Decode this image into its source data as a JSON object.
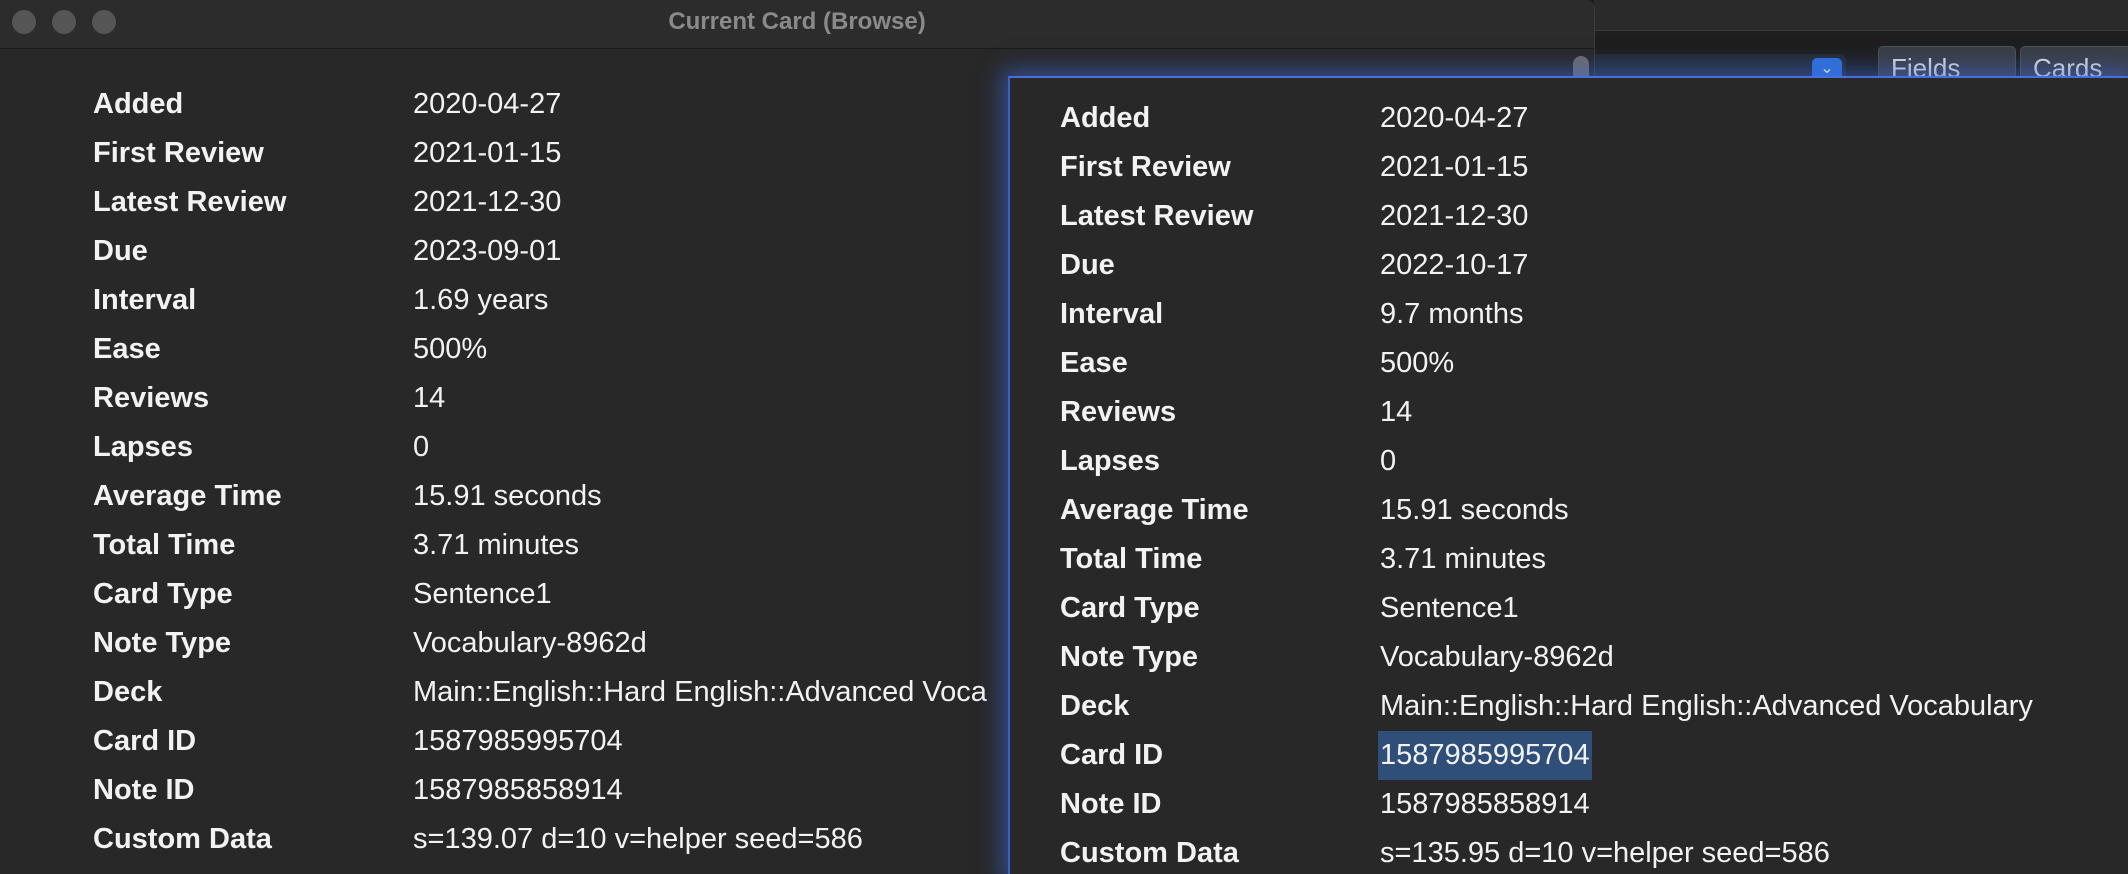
{
  "left_window": {
    "title": "Current Card (Browse)",
    "rows": [
      {
        "label": "Added",
        "value": "2020-04-27"
      },
      {
        "label": "First Review",
        "value": "2021-01-15"
      },
      {
        "label": "Latest Review",
        "value": "2021-12-30"
      },
      {
        "label": "Due",
        "value": "2023-09-01"
      },
      {
        "label": "Interval",
        "value": "1.69 years"
      },
      {
        "label": "Ease",
        "value": "500%"
      },
      {
        "label": "Reviews",
        "value": "14"
      },
      {
        "label": "Lapses",
        "value": "0"
      },
      {
        "label": "Average Time",
        "value": "15.91 seconds"
      },
      {
        "label": "Total Time",
        "value": "3.71 minutes"
      },
      {
        "label": "Card Type",
        "value": "Sentence1"
      },
      {
        "label": "Note Type",
        "value": "Vocabulary-8962d"
      },
      {
        "label": "Deck",
        "value": "Main::English::Hard English::Advanced Voca"
      },
      {
        "label": "Card ID",
        "value": "1587985995704"
      },
      {
        "label": "Note ID",
        "value": "1587985858914"
      },
      {
        "label": "Custom Data",
        "value": "s=139.07 d=10 v=helper seed=586"
      }
    ]
  },
  "right_window": {
    "rows": [
      {
        "label": "Added",
        "value": "2020-04-27"
      },
      {
        "label": "First Review",
        "value": "2021-01-15"
      },
      {
        "label": "Latest Review",
        "value": "2021-12-30"
      },
      {
        "label": "Due",
        "value": "2022-10-17"
      },
      {
        "label": "Interval",
        "value": "9.7 months"
      },
      {
        "label": "Ease",
        "value": "500%"
      },
      {
        "label": "Reviews",
        "value": "14"
      },
      {
        "label": "Lapses",
        "value": "0"
      },
      {
        "label": "Average Time",
        "value": "15.91 seconds"
      },
      {
        "label": "Total Time",
        "value": "3.71 minutes"
      },
      {
        "label": "Card Type",
        "value": "Sentence1"
      },
      {
        "label": "Note Type",
        "value": "Vocabulary-8962d"
      },
      {
        "label": "Deck",
        "value": "Main::English::Hard English::Advanced Vocabulary"
      },
      {
        "label": "Card ID",
        "value": "1587985995704",
        "selected": true
      },
      {
        "label": "Note ID",
        "value": "1587985858914"
      },
      {
        "label": "Custom Data",
        "value": "s=135.95 d=10 v=helper seed=586"
      }
    ]
  },
  "background_browser": {
    "tabs": [
      {
        "label": "Fields"
      },
      {
        "label": "Cards"
      }
    ],
    "dropdown_icon": "chevron-down-icon"
  },
  "colors": {
    "window_bg": "#282828",
    "text": "#f2f2f2",
    "selection": "#2f4f78",
    "focus_glow": "#3b6fe6"
  }
}
